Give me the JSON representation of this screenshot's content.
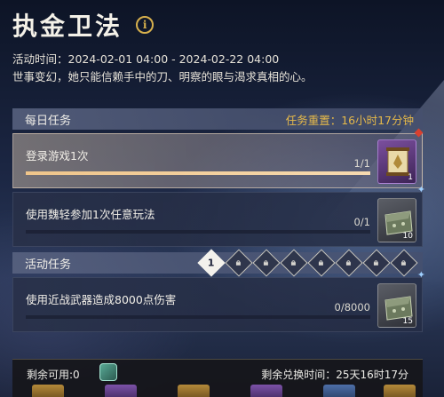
{
  "event": {
    "title": "执金卫法",
    "time_label": "活动时间：2024-02-01 04:00 - 2024-02-22 04:00",
    "description": "世事变幻，她只能信赖手中的刀、明察的眼与渴求真相的心。"
  },
  "daily": {
    "header": "每日任务",
    "reset_text": "任务重置：16小时17分钟",
    "tasks": [
      {
        "name": "登录游戏1次",
        "progress_text": "1/1",
        "progress": 1.0,
        "reward_count": "1",
        "reward_icon": "scroll-icon",
        "reward_rarity": "purple",
        "completed": true
      },
      {
        "name": "使用魏轻参加1次任意玩法",
        "progress_text": "0/1",
        "progress": 0.0,
        "reward_count": "10",
        "reward_icon": "ore-chest-icon",
        "reward_rarity": "white",
        "completed": false
      }
    ]
  },
  "event_tasks": {
    "header": "活动任务",
    "stages": [
      "1",
      "lock",
      "lock",
      "lock",
      "lock",
      "lock",
      "lock",
      "lock"
    ],
    "tasks": [
      {
        "name": "使用近战武器造成8000点伤害",
        "progress_text": "0/8000",
        "progress": 0.0,
        "reward_count": "15",
        "reward_icon": "ore-chest-icon",
        "reward_rarity": "white"
      }
    ]
  },
  "exchange": {
    "remaining_label": "剩余可用:0",
    "remaining_time": "剩余兑换时间：25天16时17分",
    "currency_icon": "jade-token-icon",
    "item_rarities": [
      "gold",
      "purple",
      "gold",
      "purple",
      "blue",
      "gold",
      "purple"
    ]
  },
  "colors": {
    "accent_gold": "#e5b94a",
    "progress_fill": "#f0c58a",
    "reddot": "#d8402f"
  }
}
